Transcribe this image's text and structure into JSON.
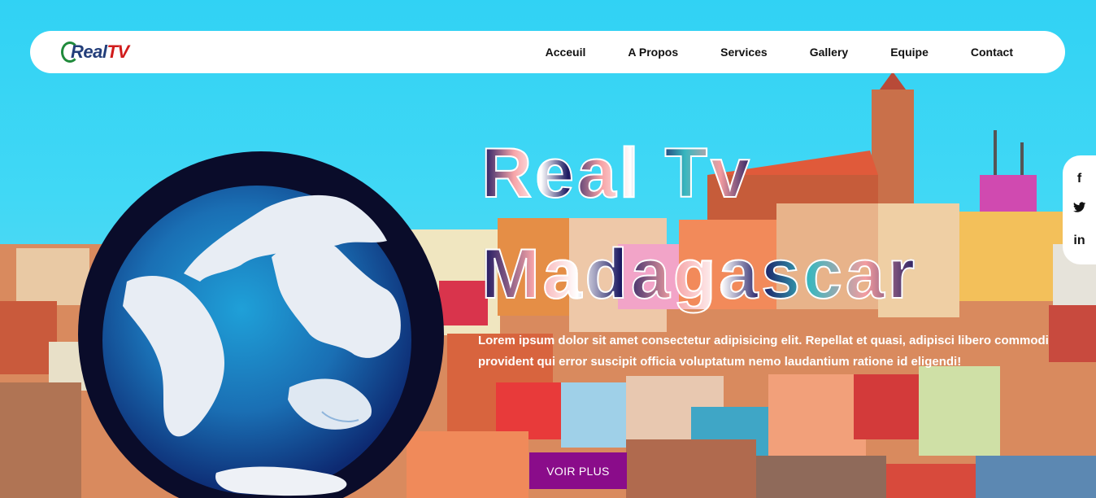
{
  "brand": {
    "logo_part1": "Real",
    "logo_part2": "TV"
  },
  "nav": {
    "items": [
      "Acceuil",
      "A Propos",
      "Services",
      "Gallery",
      "Equipe",
      "Contact"
    ]
  },
  "social": {
    "facebook": "f",
    "twitter": "🐦",
    "linkedin": "in"
  },
  "hero": {
    "title_line1": "Real Tv",
    "title_line2": "Madagascar",
    "description": "Lorem ipsum dolor sit amet consectetur adipisicing elit. Repellat et quasi, adipisci libero commodi provident qui error suscipit officia voluptatum nemo laudantium ratione id eligendi!",
    "cta_label": "VOIR PLUS"
  },
  "icons": {
    "facebook": "facebook-icon",
    "twitter": "twitter-icon",
    "linkedin": "linkedin-icon",
    "globe": "globe-image"
  },
  "colors": {
    "sky": "#35d4f3",
    "cta": "#8a0c8a",
    "navbar": "#ffffff",
    "logo_blue": "#233e7a",
    "logo_red": "#d11c1c"
  }
}
